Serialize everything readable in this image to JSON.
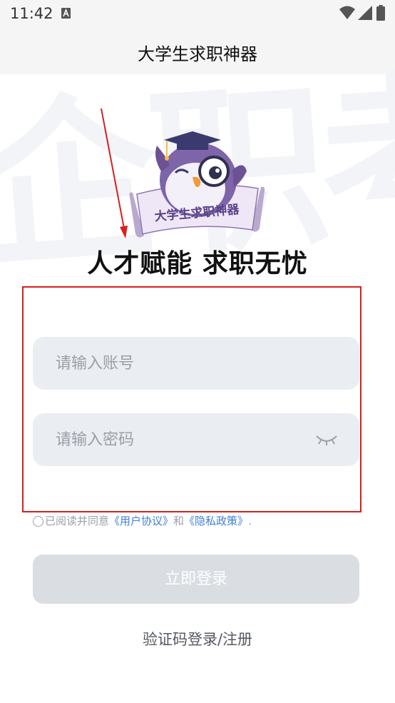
{
  "status_bar": {
    "time": "11:42",
    "notification_icon": "a-letter-icon",
    "wifi_icon": "wifi-icon",
    "signal_icon": "cell-signal-icon",
    "battery_icon": "battery-icon"
  },
  "header": {
    "title": "大学生求职神器"
  },
  "hero": {
    "watermark_text": "企职考",
    "mascot_banner_text": "大学生求职神器",
    "slogan": "人才赋能 求职无忧"
  },
  "form": {
    "account_placeholder": "请输入账号",
    "account_value": "",
    "password_placeholder": "请输入密码",
    "password_value": "",
    "password_toggle_icon": "eye-closed-icon"
  },
  "agreement": {
    "prefix": "已阅读并同意",
    "user_agreement_link": "《用户协议》",
    "conjunction": "和",
    "privacy_policy_link": "《隐私政策》",
    "suffix": "."
  },
  "actions": {
    "login_label": "立即登录",
    "alt_login_label": "验证码登录/注册"
  },
  "colors": {
    "accent_link": "#3f7fd9",
    "annotation_red": "#d81e1e",
    "input_bg": "#eaedf1",
    "disabled_button": "#dadde2"
  }
}
